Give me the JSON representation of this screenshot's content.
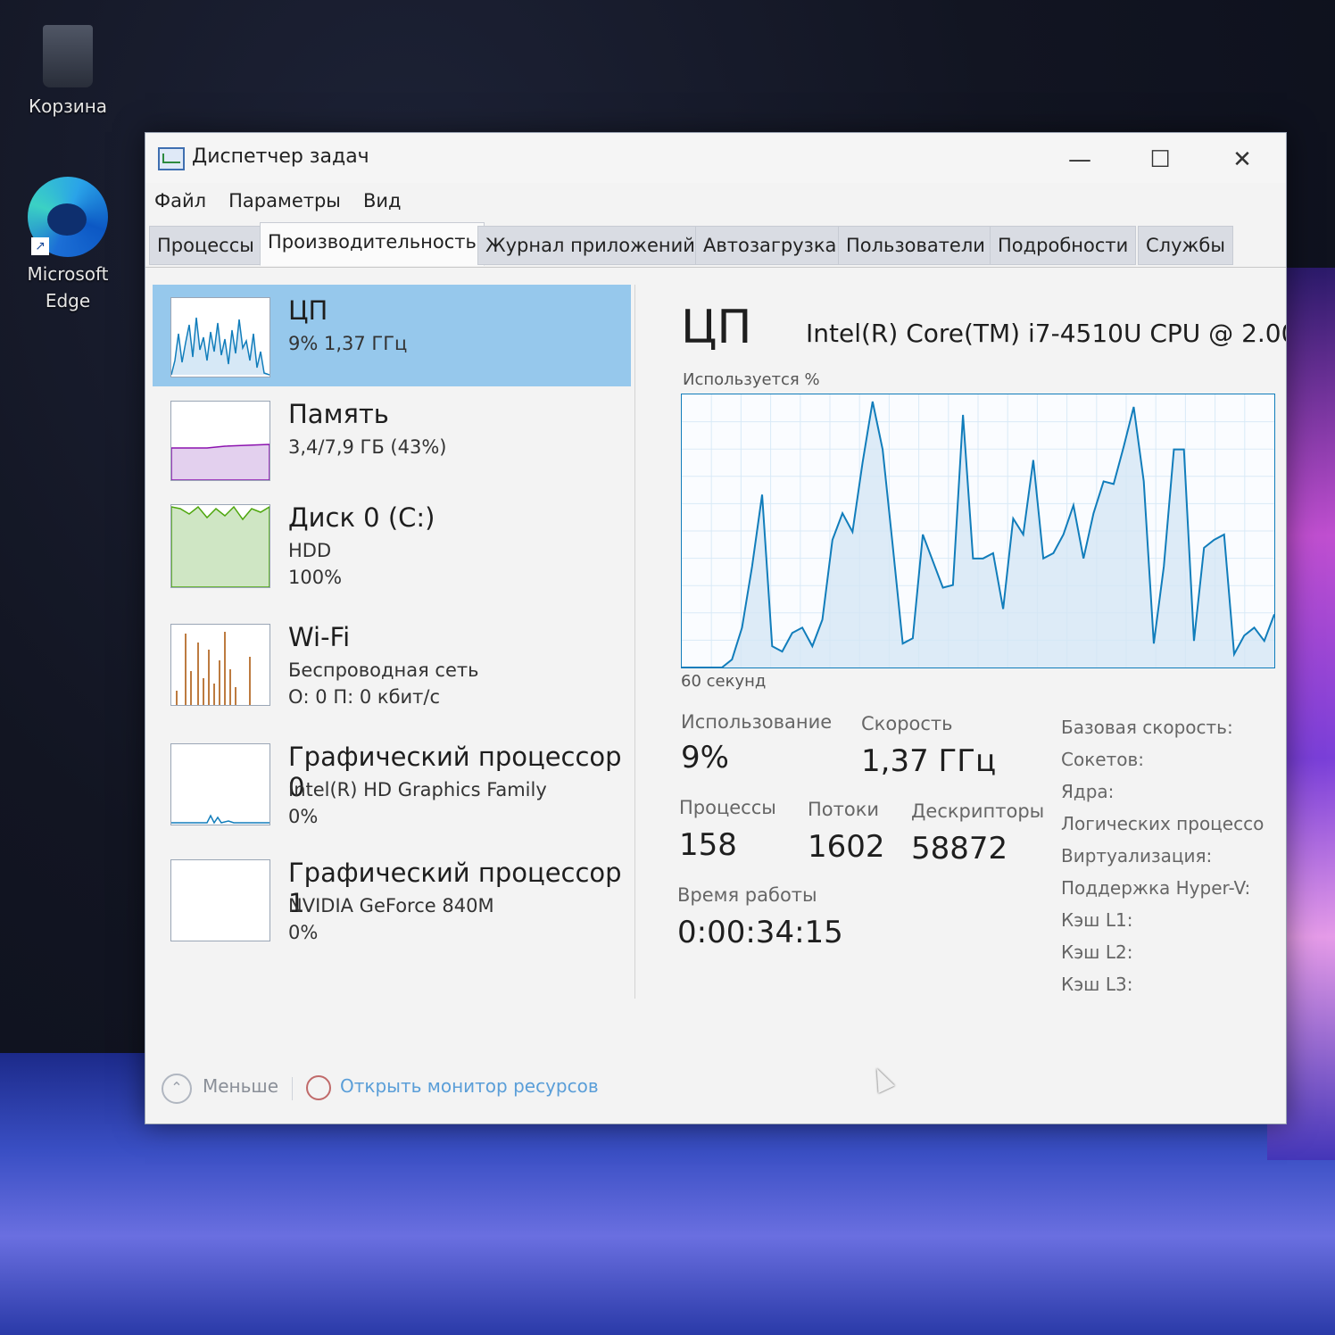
{
  "desktop": {
    "icons": [
      {
        "label": "Корзина",
        "icon": "recycle-bin-icon"
      },
      {
        "label": "Microsoft",
        "label2": "Edge",
        "icon": "edge-icon"
      }
    ]
  },
  "window": {
    "title": "Диспетчер задач",
    "controls": {
      "minimize": "—",
      "maximize": "☐",
      "close": "✕"
    },
    "menu": [
      "Файл",
      "Параметры",
      "Вид"
    ],
    "tabs": [
      {
        "label": "Процессы",
        "active": false
      },
      {
        "label": "Производительность",
        "active": true
      },
      {
        "label": "Журнал приложений",
        "active": false
      },
      {
        "label": "Автозагрузка",
        "active": false
      },
      {
        "label": "Пользователи",
        "active": false
      },
      {
        "label": "Подробности",
        "active": false
      },
      {
        "label": "Службы",
        "active": false
      }
    ]
  },
  "resources": [
    {
      "title": "ЦП",
      "line1": "9%  1,37 ГГц",
      "line2": "",
      "color": "#117dbb",
      "selected": true
    },
    {
      "title": "Память",
      "line1": "3,4/7,9 ГБ (43%)",
      "line2": "",
      "color": "#8b12ae",
      "selected": false
    },
    {
      "title": "Диск 0 (C:)",
      "line1": "HDD",
      "line2": "100%",
      "color": "#4da60c",
      "selected": false
    },
    {
      "title": "Wi-Fi",
      "line1": "Беспроводная сеть",
      "line2": "О: 0  П: 0 кбит/с",
      "color": "#a74f01",
      "selected": false
    },
    {
      "title": "Графический процессор 0",
      "line1": "Intel(R) HD Graphics Family",
      "line2": "0%",
      "color": "#117dbb",
      "selected": false
    },
    {
      "title": "Графический процессор 1",
      "line1": "NVIDIA GeForce 840M",
      "line2": "0%",
      "color": "#117dbb",
      "selected": false
    }
  ],
  "detail": {
    "title": "ЦП",
    "cpu_name": "Intel(R) Core(TM) i7-4510U CPU @ 2.00",
    "graph_label": "Используется %",
    "axis_label": "60 секунд",
    "stats": {
      "usage_label": "Использование",
      "usage_value": "9%",
      "speed_label": "Скорость",
      "speed_value": "1,37 ГГц",
      "processes_label": "Процессы",
      "processes_value": "158",
      "threads_label": "Потоки",
      "threads_value": "1602",
      "handles_label": "Дескрипторы",
      "handles_value": "58872",
      "uptime_label": "Время работы",
      "uptime_value": "0:00:34:15"
    },
    "specs": [
      "Базовая скорость:",
      "Сокетов:",
      "Ядра:",
      "Логических процессо",
      "Виртуализация:",
      "Поддержка Hyper-V:",
      "Кэш L1:",
      "Кэш L2:",
      "Кэш L3:"
    ]
  },
  "chart_data": {
    "type": "area",
    "title": "",
    "xlabel": "60 секунд",
    "ylabel": "Используется %",
    "ylim": [
      0,
      100
    ],
    "x": [
      0,
      1,
      2,
      3,
      4,
      5,
      6,
      7,
      8,
      9,
      10,
      11,
      12,
      13,
      14,
      15,
      16,
      17,
      18,
      19,
      20,
      21,
      22,
      23,
      24,
      25,
      26,
      27,
      28,
      29,
      30,
      31,
      32,
      33,
      34,
      35,
      36,
      37,
      38,
      39,
      40,
      41,
      42,
      43,
      44,
      45,
      46,
      47,
      48,
      49,
      50,
      51,
      52,
      53,
      54,
      55,
      56,
      57,
      58,
      59
    ],
    "series": [
      {
        "values": [
          0,
          0,
          0,
          0,
          0,
          3,
          15,
          38,
          65,
          8,
          6,
          13,
          15,
          8,
          18,
          48,
          58,
          51,
          77,
          100,
          82,
          46,
          9,
          11,
          50,
          40,
          30,
          31,
          95,
          41,
          41,
          43,
          22,
          56,
          50,
          78,
          41,
          43,
          50,
          61,
          41,
          58,
          70,
          69,
          83,
          98,
          70,
          9,
          38,
          82,
          82,
          10,
          45,
          48,
          50,
          5,
          12,
          15,
          10,
          20
        ]
      }
    ],
    "grid": true
  },
  "footer": {
    "less": "Меньше",
    "monitor": "Открыть монитор ресурсов"
  }
}
